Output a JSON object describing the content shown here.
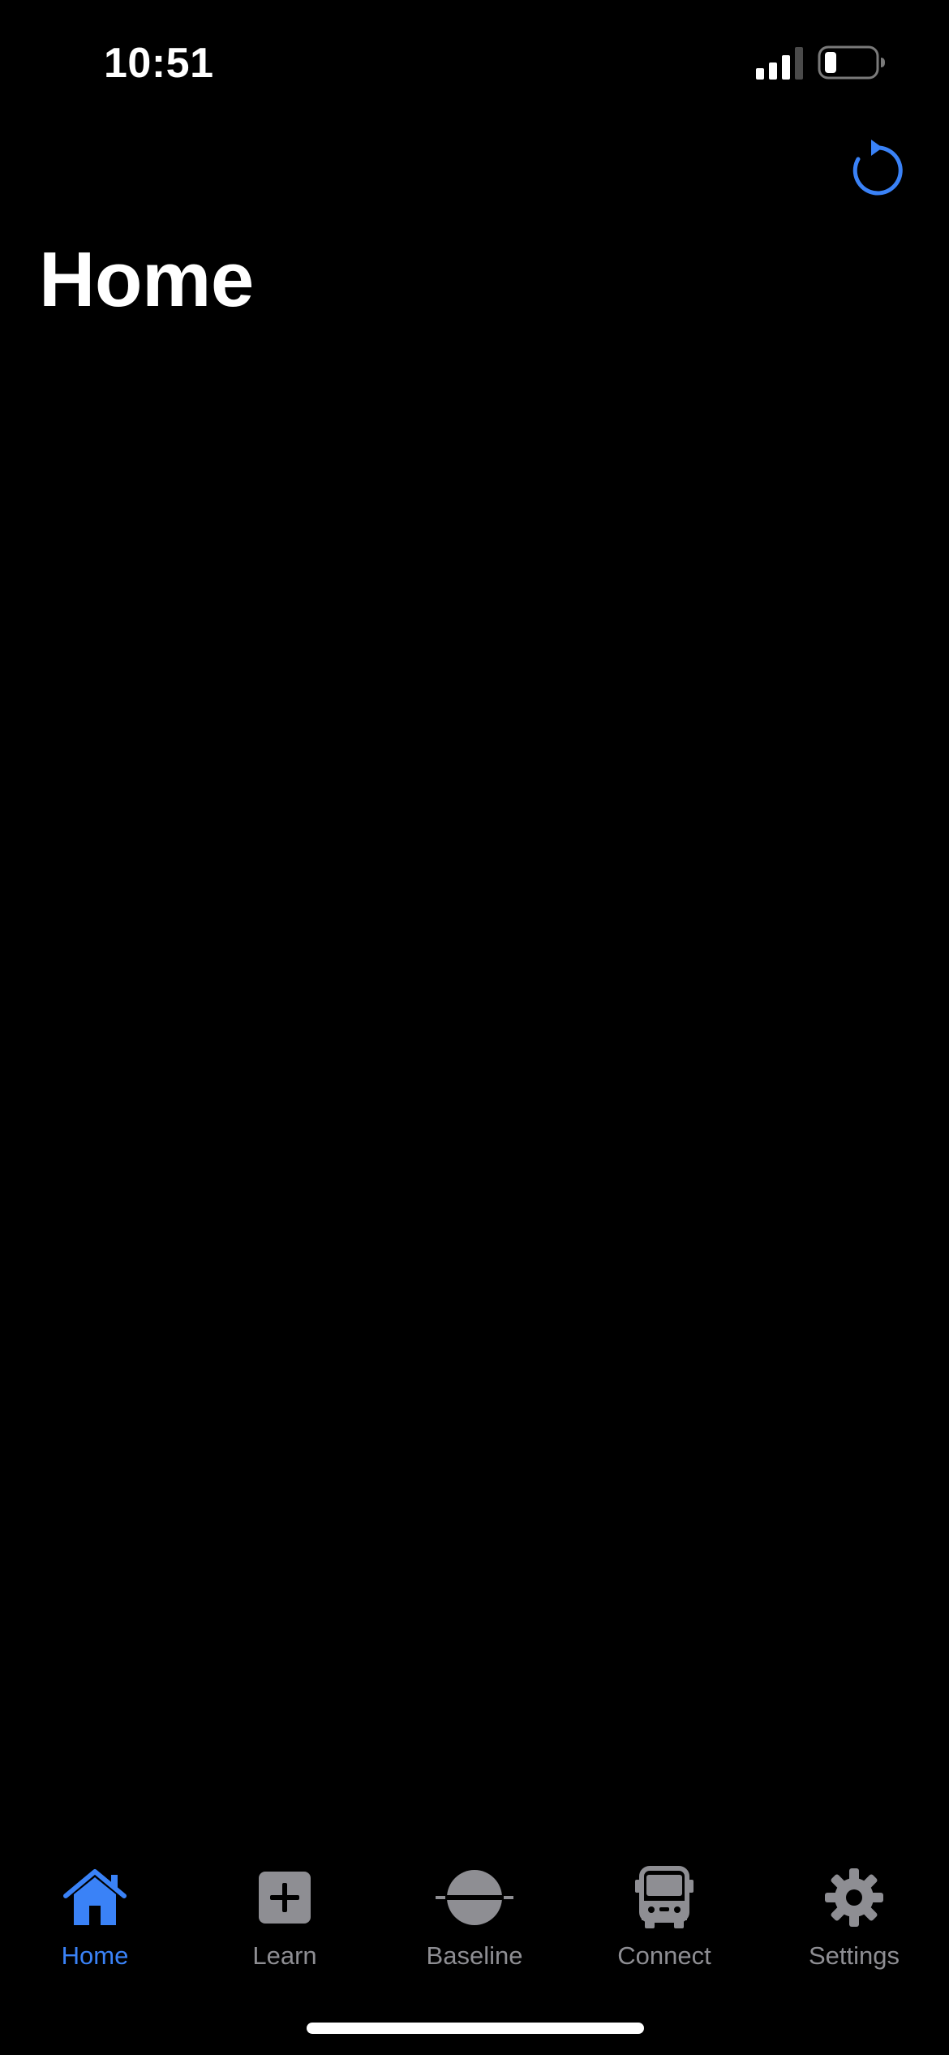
{
  "status_bar": {
    "time": "10:51",
    "signal_icon": "cellular-signal-icon",
    "battery_icon": "battery-low-icon"
  },
  "toolbar": {
    "refresh_icon": "refresh-icon"
  },
  "header": {
    "title": "Home"
  },
  "tab_bar": {
    "tabs": [
      {
        "label": "Home",
        "icon": "house-icon",
        "active": true
      },
      {
        "label": "Learn",
        "icon": "plus-square-icon",
        "active": false
      },
      {
        "label": "Baseline",
        "icon": "baseline-circle-icon",
        "active": false
      },
      {
        "label": "Connect",
        "icon": "bus-icon",
        "active": false
      },
      {
        "label": "Settings",
        "icon": "gear-icon",
        "active": false
      }
    ]
  },
  "colors": {
    "accent": "#3a82f7",
    "inactive": "#8e8e93",
    "background": "#000000"
  }
}
